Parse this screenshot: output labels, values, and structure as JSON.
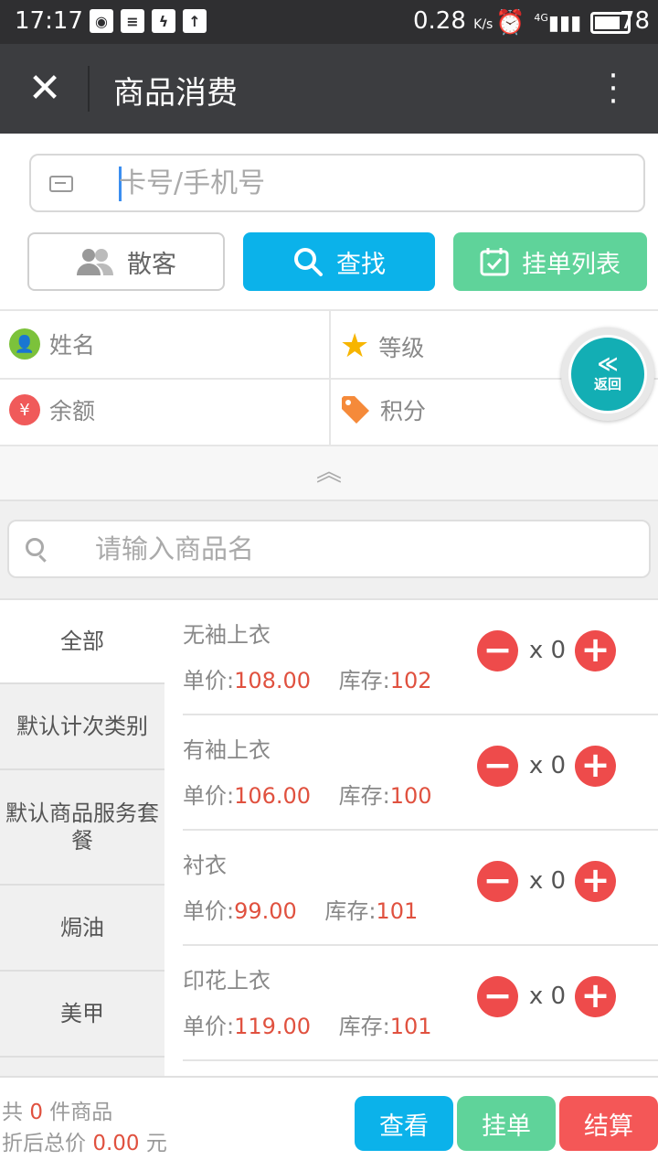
{
  "status": {
    "time": "17:17",
    "speed": "0.28",
    "speed_unit": "K/s",
    "battery": "78",
    "network": "4G"
  },
  "header": {
    "title": "商品消费"
  },
  "member": {
    "card_placeholder": "卡号/手机号",
    "guest_label": "散客",
    "find_label": "查找",
    "hang_list_label": "挂单列表",
    "name_label": "姓名",
    "level_label": "等级",
    "balance_label": "余额",
    "points_label": "积分",
    "balance_symbol": "¥"
  },
  "back_button": {
    "label": "返回"
  },
  "product_search": {
    "placeholder": "请输入商品名"
  },
  "categories": [
    {
      "label": "全部",
      "active": true
    },
    {
      "label": "默认计次类别",
      "active": false
    },
    {
      "label": "默认商品服务套餐",
      "active": false
    },
    {
      "label": "焗油",
      "active": false
    },
    {
      "label": "美甲",
      "active": false
    }
  ],
  "products": [
    {
      "name": "无袖上衣",
      "price_label": "单价:",
      "price": "108.00",
      "stock_label": "库存:",
      "stock": "102",
      "qty": "x 0"
    },
    {
      "name": "有袖上衣",
      "price_label": "单价:",
      "price": "106.00",
      "stock_label": "库存:",
      "stock": "100",
      "qty": "x 0"
    },
    {
      "name": "衬衣",
      "price_label": "单价:",
      "price": "99.00",
      "stock_label": "库存:",
      "stock": "101",
      "qty": "x 0"
    },
    {
      "name": "印花上衣",
      "price_label": "单价:",
      "price": "119.00",
      "stock_label": "库存:",
      "stock": "101",
      "qty": "x 0"
    }
  ],
  "footer": {
    "count_prefix": "共",
    "count": "0",
    "count_suffix": "件商品",
    "total_prefix": "折后总价",
    "total": "0.00",
    "total_suffix": "元",
    "view_label": "查看",
    "hang_label": "挂单",
    "checkout_label": "结算"
  },
  "colors": {
    "blue": "#0bb2ea",
    "green": "#5fd39a",
    "red": "#ee4b4b",
    "price_red": "#e0513f"
  }
}
